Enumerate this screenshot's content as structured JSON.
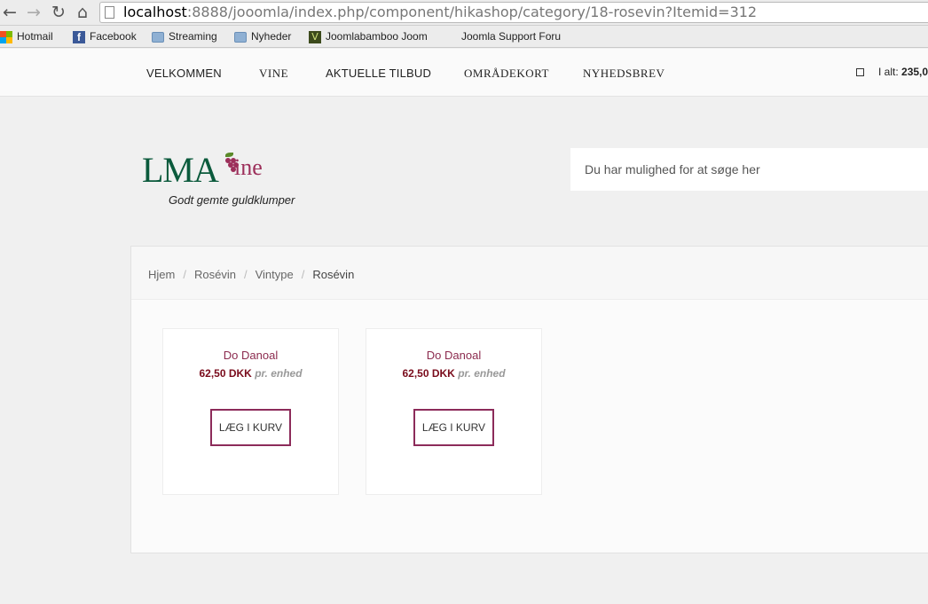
{
  "browser": {
    "url_host": "localhost",
    "url_rest": ":8888/jooomla/index.php/component/hikashop/category/18-rosevin?Itemid=312",
    "bookmarks": [
      "Hotmail",
      "Facebook",
      "Streaming",
      "Nyheder",
      "Joomlabamboo Joom",
      "Joomla Support Foru"
    ]
  },
  "nav": {
    "items": [
      "VELKOMMEN",
      "VINE",
      "AKTUELLE TILBUD",
      "OMRÅDEKORT",
      "NYHEDSBREV"
    ],
    "cart_label": "I alt:",
    "cart_amount": "235,0"
  },
  "logo": {
    "brand": "LMA",
    "brand_suffix": "ine",
    "tagline": "Godt gemte guldklumper"
  },
  "search": {
    "placeholder": "Du har mulighed for at søge her"
  },
  "breadcrumb": [
    "Hjem",
    "Rosévin",
    "Vintype",
    "Rosévin"
  ],
  "products": [
    {
      "name": "Do Danoal",
      "price": "62,50 DKK",
      "unit": "pr. enhed",
      "button": "LÆG I KURV"
    },
    {
      "name": "Do Danoal",
      "price": "62,50 DKK",
      "unit": "pr. enhed",
      "button": "LÆG I KURV"
    }
  ],
  "colors": {
    "brand_green": "#0b5a3c",
    "brand_wine": "#9c2f5a",
    "price": "#7a0c1c"
  }
}
